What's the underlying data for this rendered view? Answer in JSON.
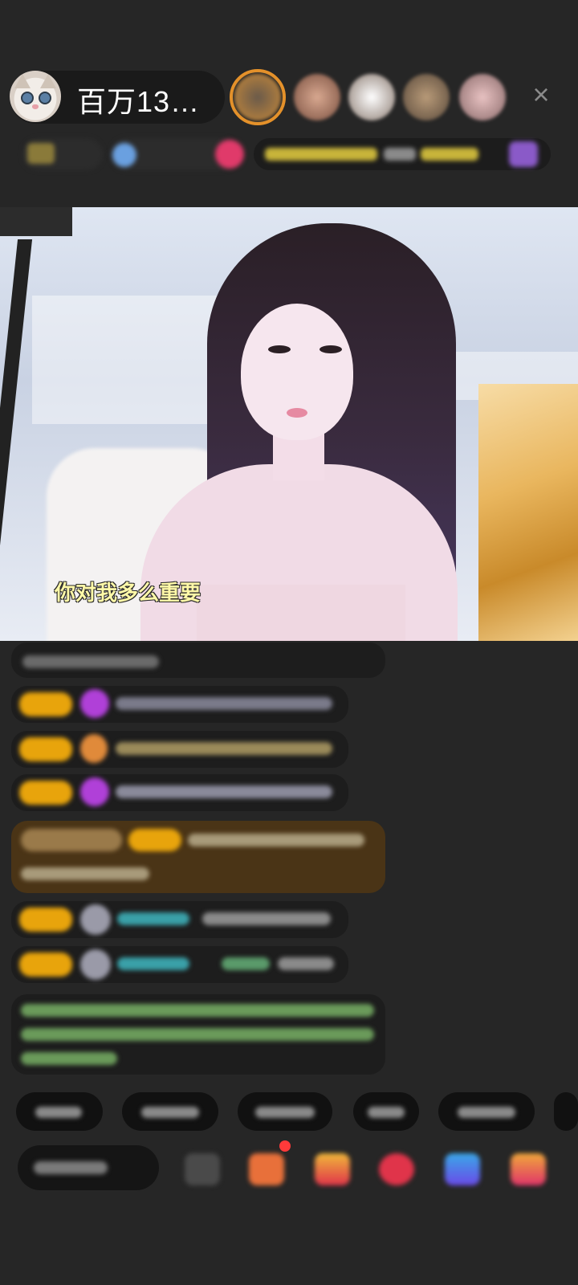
{
  "header": {
    "host_name": "百万13…",
    "close_label": "×"
  },
  "video": {
    "lyric": "你对我多么重要"
  }
}
